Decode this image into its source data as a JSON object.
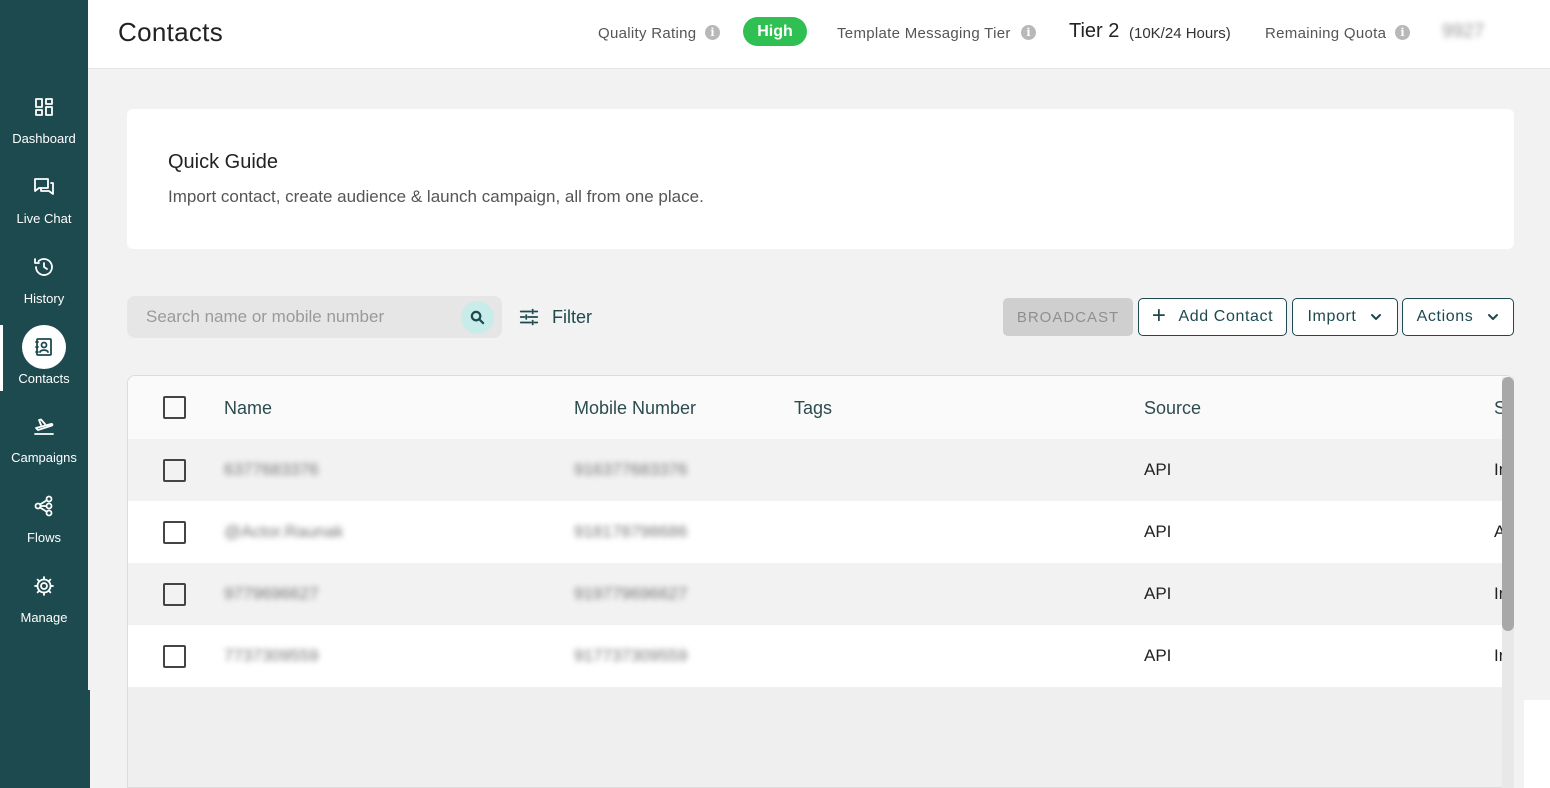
{
  "sidebar": {
    "items": [
      {
        "label": "Dashboard",
        "icon": "dashboard-icon"
      },
      {
        "label": "Live Chat",
        "icon": "chat-icon"
      },
      {
        "label": "History",
        "icon": "history-icon"
      },
      {
        "label": "Contacts",
        "icon": "contacts-icon",
        "active": true
      },
      {
        "label": "Campaigns",
        "icon": "plane-icon"
      },
      {
        "label": "Flows",
        "icon": "flow-icon"
      },
      {
        "label": "Manage",
        "icon": "gear-icon"
      }
    ]
  },
  "header": {
    "title": "Contacts",
    "quality_label": "Quality Rating",
    "quality_value": "High",
    "tier_label": "Template Messaging Tier",
    "tier_value": "Tier 2",
    "tier_sub": "(10K/24 Hours)",
    "quota_label": "Remaining Quota",
    "quota_value": "9927",
    "info_glyph": "i"
  },
  "guide": {
    "title": "Quick Guide",
    "description": "Import contact, create audience & launch campaign, all from one place."
  },
  "toolbar": {
    "search_placeholder": "Search name or mobile number",
    "filter_label": "Filter",
    "broadcast_label": "BROADCAST",
    "add_contact_label": "Add Contact",
    "import_label": "Import",
    "actions_label": "Actions"
  },
  "table": {
    "columns": [
      "Name",
      "Mobile Number",
      "Tags",
      "Source",
      "S"
    ],
    "rows": [
      {
        "name": "6377683376",
        "mobile": "916377683376",
        "tags": "",
        "source": "API",
        "clip": "In"
      },
      {
        "name": "@Actor.Raunak",
        "mobile": "918178798686",
        "tags": "",
        "source": "API",
        "clip": "A"
      },
      {
        "name": "9779696627",
        "mobile": "919779696627",
        "tags": "",
        "source": "API",
        "clip": "In"
      },
      {
        "name": "7737309559",
        "mobile": "917737309559",
        "tags": "",
        "source": "API",
        "clip": "In"
      }
    ]
  },
  "colors": {
    "sidebar": "#1d4a4e",
    "badge_green": "#2fbf52",
    "search_button": "#c7ecea"
  }
}
